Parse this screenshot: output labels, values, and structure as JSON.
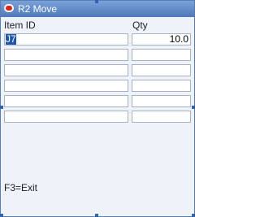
{
  "window": {
    "title": "R2 Move",
    "icon": "oracle-logo-icon"
  },
  "columns": {
    "item_id": "Item ID",
    "qty": "Qty"
  },
  "rows": [
    {
      "item_id": "J7",
      "qty": "10.0"
    },
    {
      "item_id": "",
      "qty": ""
    },
    {
      "item_id": "",
      "qty": ""
    },
    {
      "item_id": "",
      "qty": ""
    },
    {
      "item_id": "",
      "qty": ""
    },
    {
      "item_id": "",
      "qty": ""
    }
  ],
  "footer": {
    "hint": "F3=Exit"
  }
}
